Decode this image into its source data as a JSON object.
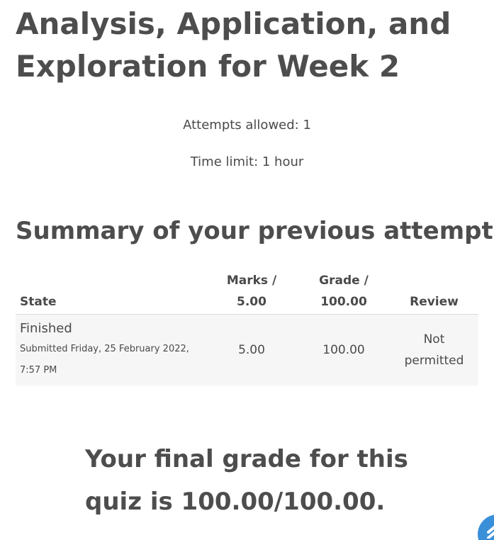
{
  "quiz": {
    "title": "Analysis, Application, and Exploration for Week 2",
    "attempts_allowed": "Attempts allowed: 1",
    "time_limit": "Time limit: 1 hour"
  },
  "summary": {
    "heading": "Summary of your previous attempts",
    "columns": {
      "state": "State",
      "marks": "Marks / 5.00",
      "grade": "Grade / 100.00",
      "review": "Review"
    },
    "rows": [
      {
        "state": "Finished",
        "submitted": "Submitted Friday, 25 February 2022, 7:57 PM",
        "marks": "5.00",
        "grade": "100.00",
        "review": "Not permitted"
      }
    ]
  },
  "final_grade": "Your final grade for this quiz is 100.00/100.00.",
  "icons": {
    "scroll_top": "chevron-up-icon",
    "accent": "#3a8fd9"
  }
}
